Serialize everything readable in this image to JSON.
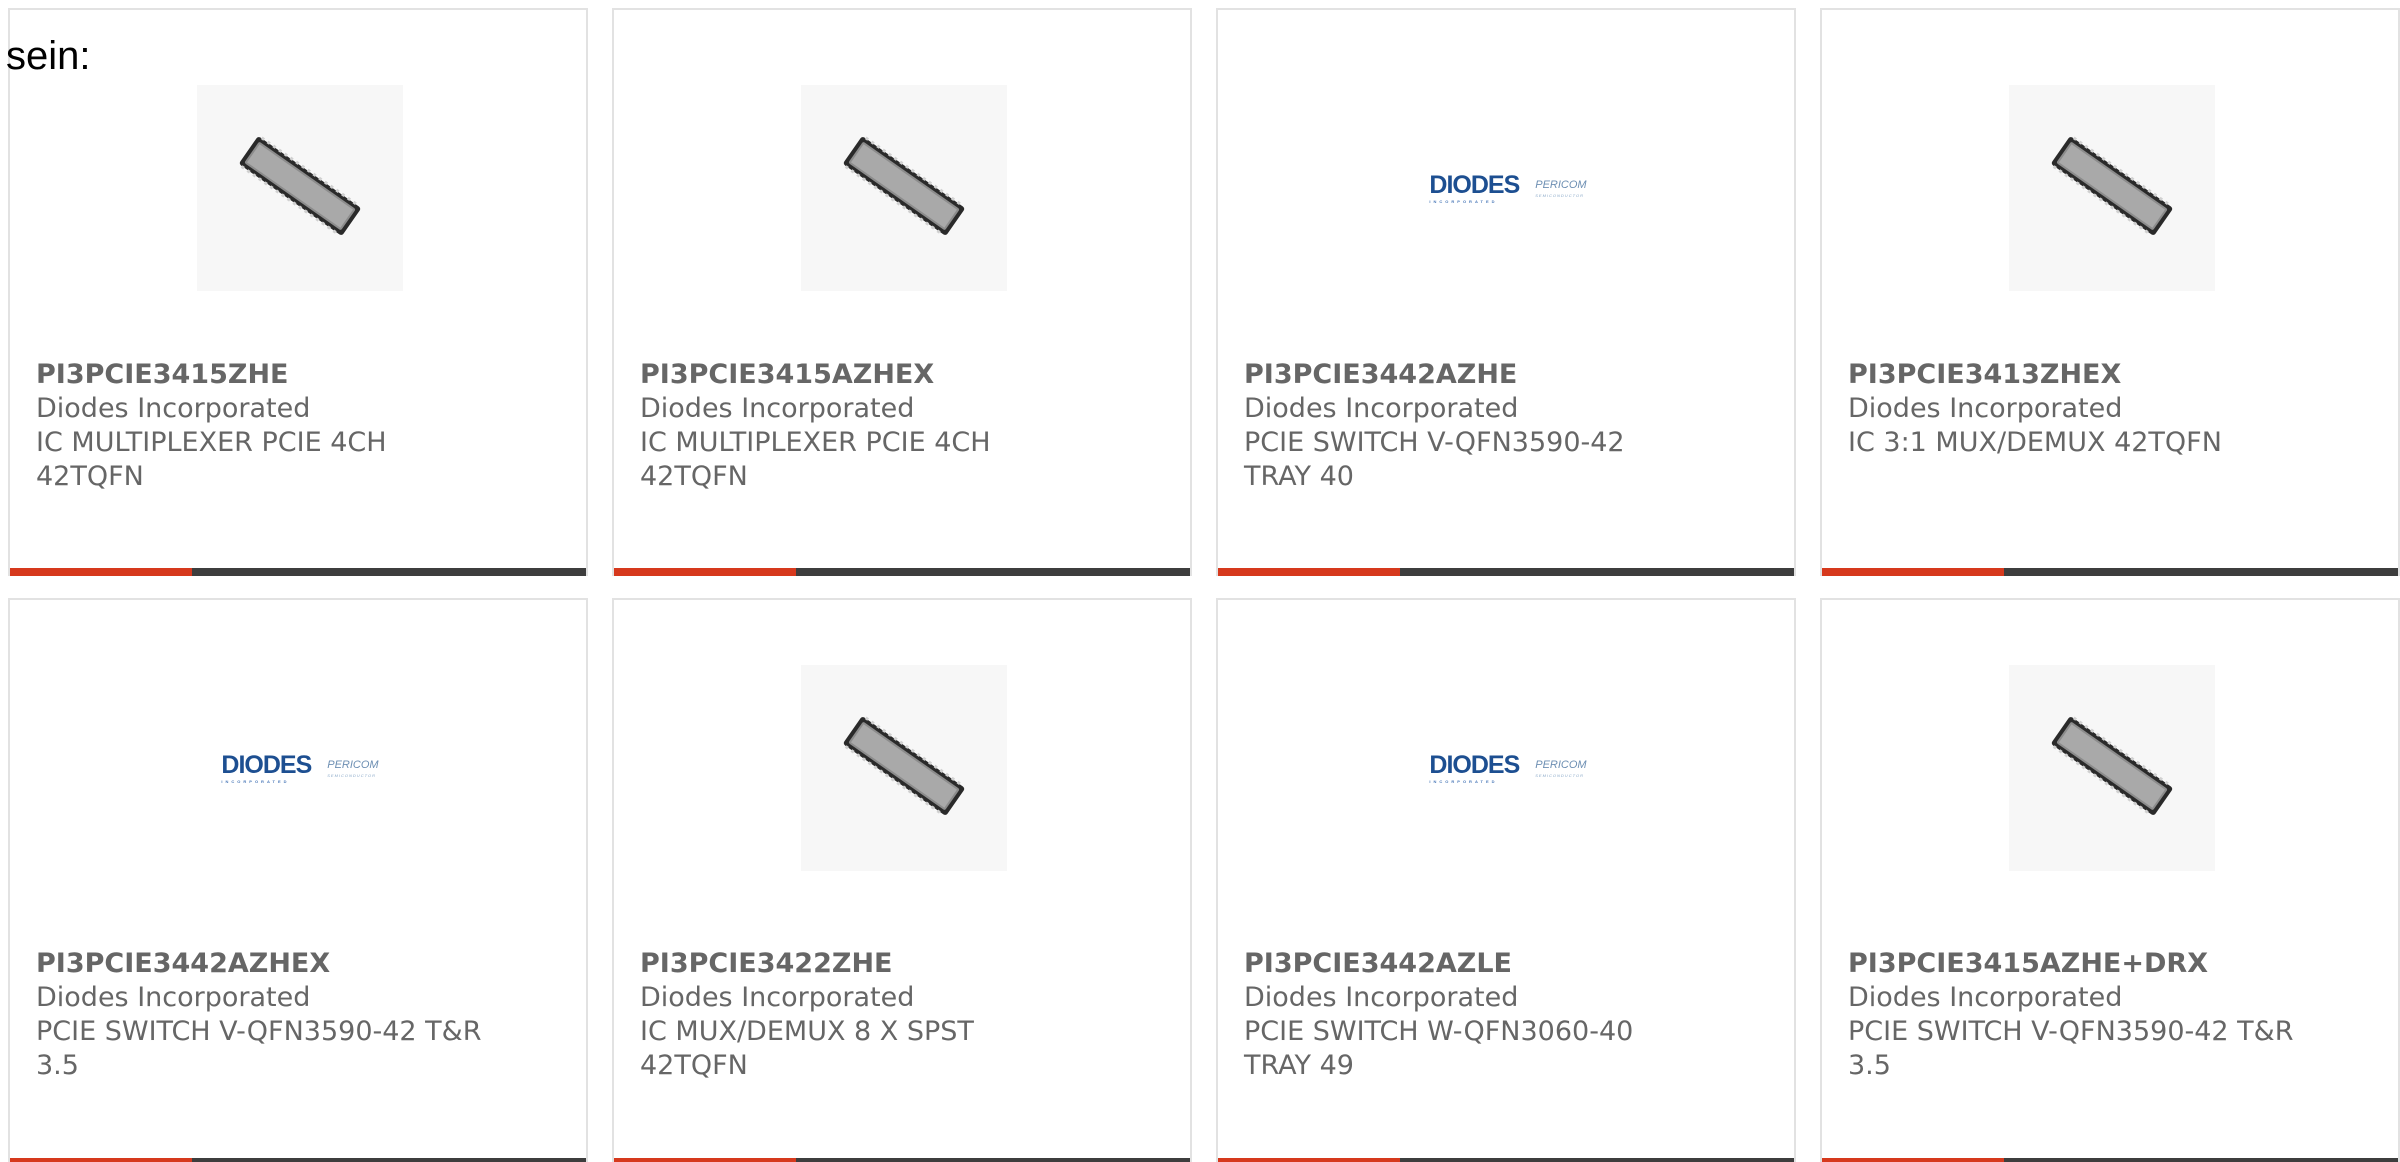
{
  "intro_text": "sein:",
  "products": [
    {
      "part_number": "PI3PCIE3415ZHE",
      "manufacturer": "Diodes Incorporated",
      "description_line1": "IC MULTIPLEXER PCIE 4CH",
      "description_line2": "42TQFN",
      "image": "chip-icon"
    },
    {
      "part_number": "PI3PCIE3415AZHEX",
      "manufacturer": "Diodes Incorporated",
      "description_line1": "IC MULTIPLEXER PCIE 4CH",
      "description_line2": "42TQFN",
      "image": "chip-icon"
    },
    {
      "part_number": "PI3PCIE3442AZHE",
      "manufacturer": "Diodes Incorporated",
      "description_line1": "PCIE SWITCH V-QFN3590-42",
      "description_line2": "TRAY 40",
      "image": "diodes-pericom-logo",
      "logo_main": "DIODES",
      "logo_main_sub": "INCORPORATED",
      "logo_secondary": "PERICOM",
      "logo_secondary_sub": "SEMICONDUCTOR"
    },
    {
      "part_number": "PI3PCIE3413ZHEX",
      "manufacturer": "Diodes Incorporated",
      "description_line1": "IC 3:1 MUX/DEMUX 42TQFN",
      "description_line2": "",
      "image": "chip-icon"
    },
    {
      "part_number": "PI3PCIE3442AZHEX",
      "manufacturer": "Diodes Incorporated",
      "description_line1": "PCIE SWITCH V-QFN3590-42 T&R",
      "description_line2": "3.5",
      "image": "diodes-pericom-logo",
      "logo_main": "DIODES",
      "logo_main_sub": "INCORPORATED",
      "logo_secondary": "PERICOM",
      "logo_secondary_sub": "SEMICONDUCTOR"
    },
    {
      "part_number": "PI3PCIE3422ZHE",
      "manufacturer": "Diodes Incorporated",
      "description_line1": "IC MUX/DEMUX 8 X SPST",
      "description_line2": "42TQFN",
      "image": "chip-icon"
    },
    {
      "part_number": "PI3PCIE3442AZLE",
      "manufacturer": "Diodes Incorporated",
      "description_line1": "PCIE SWITCH W-QFN3060-40",
      "description_line2": "TRAY 49",
      "image": "diodes-pericom-logo",
      "logo_main": "DIODES",
      "logo_main_sub": "INCORPORATED",
      "logo_secondary": "PERICOM",
      "logo_secondary_sub": "SEMICONDUCTOR"
    },
    {
      "part_number": "PI3PCIE3415AZHE+DRX",
      "manufacturer": "Diodes Incorporated",
      "description_line1": "PCIE SWITCH V-QFN3590-42 T&R",
      "description_line2": "3.5",
      "image": "chip-icon"
    }
  ],
  "colors": {
    "accent_bar": "#d6391d",
    "dark_bar": "#3d3d3d",
    "text": "#666666",
    "border": "#e2e2e2",
    "logo_blue": "#1d4f91"
  }
}
